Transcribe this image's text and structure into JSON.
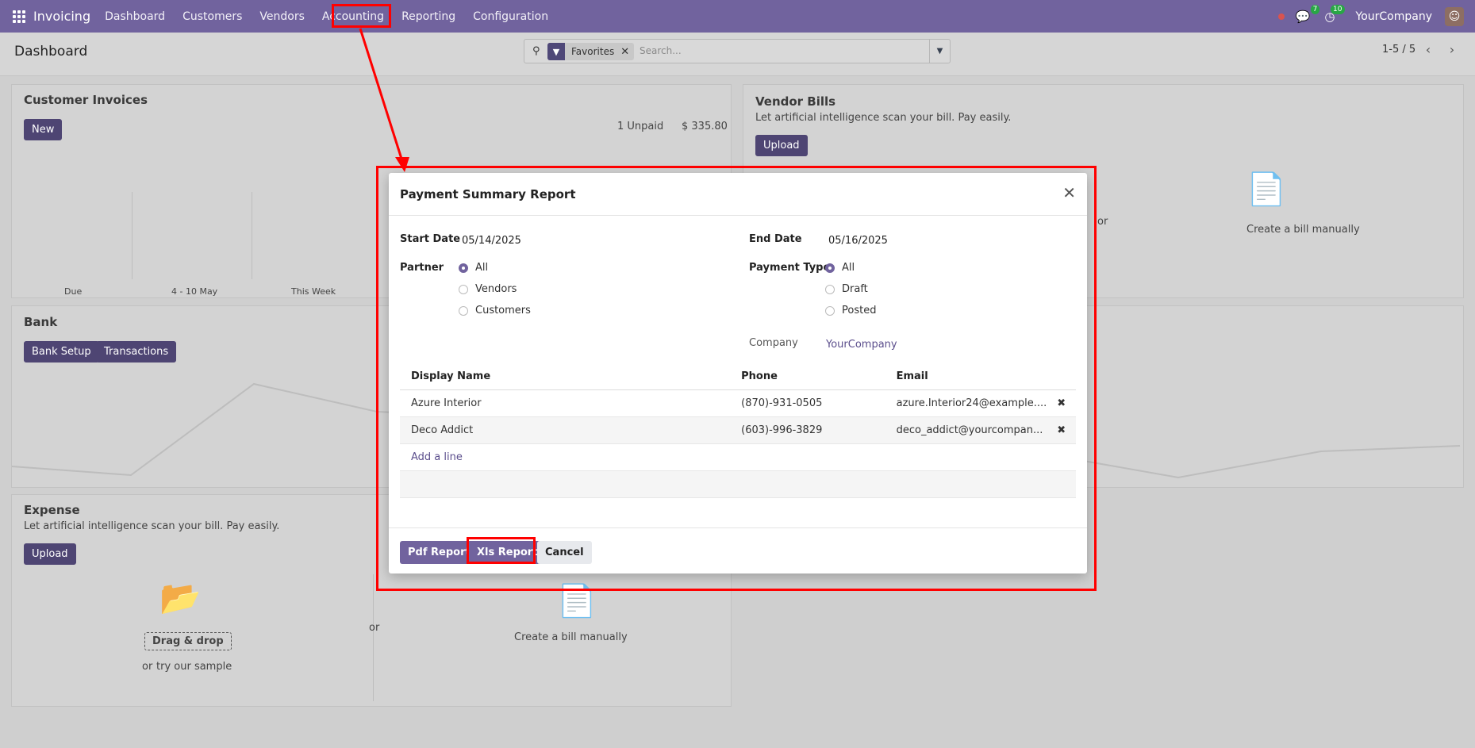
{
  "navbar": {
    "app_name": "Invoicing",
    "menu": [
      "Dashboard",
      "Customers",
      "Vendors",
      "Accounting",
      "Reporting",
      "Configuration"
    ],
    "messages_count": "7",
    "activities_count": "10",
    "company": "YourCompany"
  },
  "control_panel": {
    "title": "Dashboard",
    "search": {
      "facet": "Favorites",
      "placeholder": "Search..."
    },
    "pager": "1-5 / 5"
  },
  "cards": {
    "customer_invoices": {
      "title": "Customer Invoices",
      "new_label": "New",
      "unpaid_label": "1 Unpaid",
      "unpaid_amount": "$ 335.80",
      "ticks": [
        "Due",
        "4 - 10 May",
        "This Week"
      ]
    },
    "vendor_bills": {
      "title": "Vendor Bills",
      "subtitle": "Let artificial intelligence scan your bill. Pay easily.",
      "upload_label": "Upload",
      "or": "or",
      "create_manual": "Create a bill manually"
    },
    "bank": {
      "title": "Bank",
      "setup_label": "Bank Setup",
      "transactions_label": "Transactions"
    },
    "expense": {
      "title": "Expense",
      "subtitle": "Let artificial intelligence scan your bill. Pay easily.",
      "upload_label": "Upload",
      "drag_drop": "Drag & drop",
      "or1": "or",
      "try_sample": "try our sample",
      "or2": "or",
      "create_manual": "Create a bill manually"
    }
  },
  "dialog": {
    "title": "Payment Summary Report",
    "start_date_label": "Start Date",
    "start_date": "05/14/2025",
    "end_date_label": "End Date",
    "end_date": "05/16/2025",
    "partner_label": "Partner",
    "partner_options": [
      "All",
      "Vendors",
      "Customers"
    ],
    "payment_type_label": "Payment Type",
    "payment_type_options": [
      "All",
      "Draft",
      "Posted"
    ],
    "company_label": "Company",
    "company_value": "YourCompany",
    "columns": [
      "Display Name",
      "Phone",
      "Email"
    ],
    "rows": [
      {
        "name": "Azure Interior",
        "phone": "(870)-931-0505",
        "email": "azure.Interior24@example...."
      },
      {
        "name": "Deco Addict",
        "phone": "(603)-996-3829",
        "email": "deco_addict@yourcompan..."
      }
    ],
    "add_line": "Add a line",
    "buttons": {
      "pdf": "Pdf Report",
      "xls": "Xls Report",
      "cancel": "Cancel"
    }
  }
}
